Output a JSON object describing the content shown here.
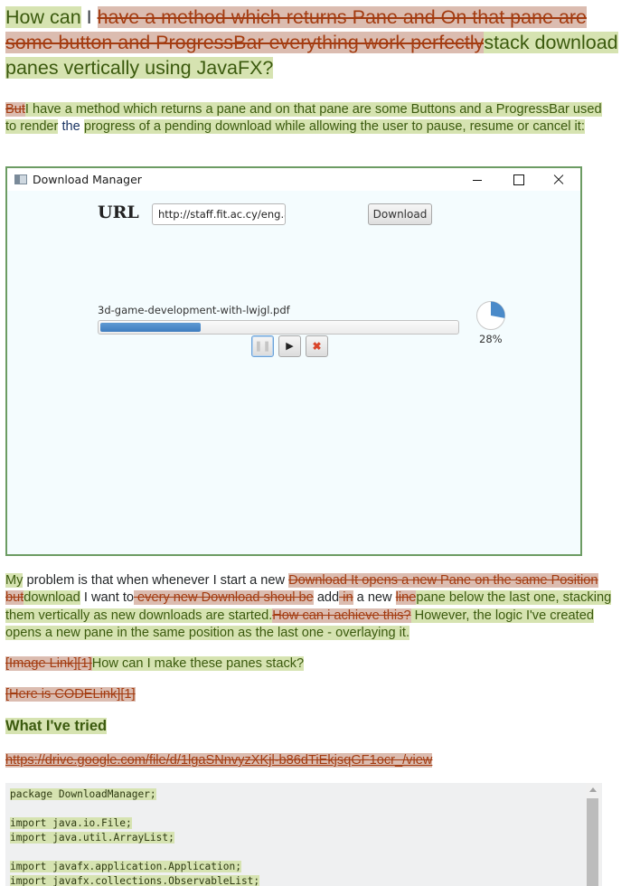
{
  "title": {
    "segments": [
      {
        "type": "ins",
        "text": "How can"
      },
      {
        "type": "plain",
        "text": " I "
      },
      {
        "type": "del",
        "text": "have a method which returns Pane and On that pane are some button and ProgressBar everything work perfectly"
      },
      {
        "type": "ins",
        "text": "stack download panes vertically using JavaFX?"
      }
    ]
  },
  "para1": {
    "segments": [
      {
        "type": "del",
        "text": "But"
      },
      {
        "type": "ins",
        "text": "I have a method which returns a pane and on that pane are some Buttons and a ProgressBar used to render"
      },
      {
        "type": "plain-blue",
        "text": " the "
      },
      {
        "type": "ins",
        "text": "progress of a pending download while allowing the user to pause, resume or cancel it:"
      }
    ]
  },
  "window": {
    "title": "Download Manager",
    "url_label": "URL",
    "url_value": "http://staff.fit.ac.cy/eng.ap",
    "download_button": "Download",
    "file_name": "3d-game-development-with-lwjgl.pdf",
    "progress": 0.28,
    "percent_label": "28%",
    "pause_icon": "pause-icon",
    "play_icon": "▶",
    "cancel_icon": "✖",
    "accent_color": "#4a8ac9"
  },
  "para2": {
    "segments": [
      {
        "type": "ins",
        "text": "My"
      },
      {
        "type": "plain",
        "text": " problem is that when whenever I start a new "
      },
      {
        "type": "del",
        "text": "Download It opens a new Pane on the same Position but"
      },
      {
        "type": "ins",
        "text": "download"
      },
      {
        "type": "plain",
        "text": " I want to"
      },
      {
        "type": "del",
        "text": " every new Download shoul be"
      },
      {
        "type": "plain",
        "text": " add"
      },
      {
        "type": "del",
        "text": " in"
      },
      {
        "type": "plain",
        "text": " a new "
      },
      {
        "type": "del",
        "text": "line"
      },
      {
        "type": "ins",
        "text": "pane below the last one, stacking them vertically as new downloads are started."
      },
      {
        "type": "del",
        "text": "How can i achieve this?"
      },
      {
        "type": "ins",
        "text": " However, the logic I've created opens a new pane in the same position as the last one - overlaying it."
      }
    ]
  },
  "para3": {
    "segments": [
      {
        "type": "del",
        "text": "[Image Link][1]"
      },
      {
        "type": "ins",
        "text": "How can I make these panes stack?"
      }
    ]
  },
  "para4": {
    "segments": [
      {
        "type": "del",
        "text": "[Here is CODELink][1]"
      }
    ]
  },
  "heading": {
    "segments": [
      {
        "type": "ins",
        "text": "What I've tried"
      }
    ]
  },
  "link": {
    "text": "https://drive.google.com/file/d/1lgaSNnvyzXKjl-b86dTiEkjsqGF1ocr_/view"
  },
  "code": {
    "lines": [
      "package DownloadManager;",
      "",
      "import java.io.File;",
      "import java.util.ArrayList;",
      "",
      "import javafx.application.Application;",
      "import javafx.collections.ObservableList;"
    ]
  },
  "colors": {
    "insert_bg": "#d6e3b1",
    "insert_text": "#3b5a0e",
    "delete_bg": "#dbbcb0",
    "delete_text": "#a33b10",
    "window_border": "#6c9c63"
  }
}
